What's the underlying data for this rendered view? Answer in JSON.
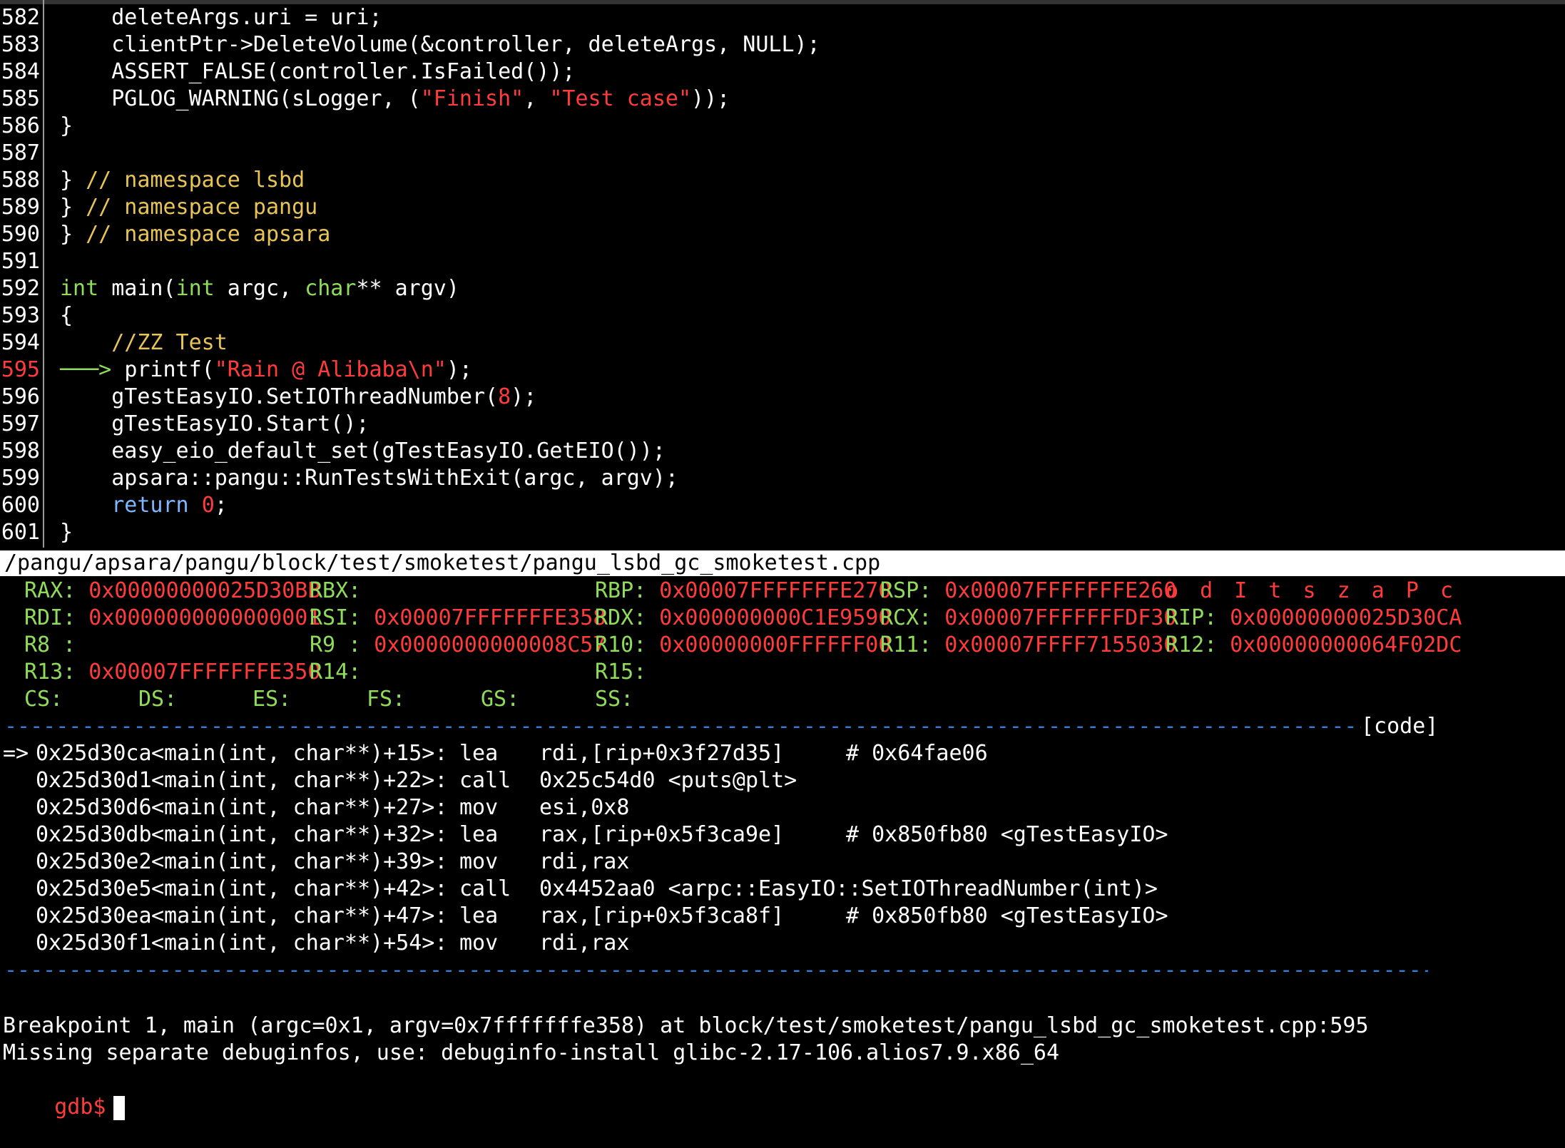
{
  "source": {
    "file_path": "/pangu/apsara/pangu/block/test/smoketest/pangu_lsbd_gc_smoketest.cpp",
    "current_line": "595",
    "lines": [
      {
        "n": "582",
        "segs": [
          [
            "p",
            "    deleteArgs.uri = uri;"
          ]
        ]
      },
      {
        "n": "583",
        "segs": [
          [
            "p",
            "    clientPtr->DeleteVolume(&controller, deleteArgs, NULL);"
          ]
        ]
      },
      {
        "n": "584",
        "segs": [
          [
            "p",
            "    ASSERT_FALSE(controller.IsFailed());"
          ]
        ]
      },
      {
        "n": "585",
        "segs": [
          [
            "p",
            "    PGLOG_WARNING(sLogger, ("
          ],
          [
            "s",
            "\"Finish\""
          ],
          [
            "p",
            ", "
          ],
          [
            "s",
            "\"Test case\""
          ],
          [
            "p",
            "));"
          ]
        ]
      },
      {
        "n": "586",
        "segs": [
          [
            "p",
            "}"
          ]
        ]
      },
      {
        "n": "587",
        "segs": []
      },
      {
        "n": "588",
        "segs": [
          [
            "p",
            "} "
          ],
          [
            "c",
            "// namespace lsbd"
          ]
        ]
      },
      {
        "n": "589",
        "segs": [
          [
            "p",
            "} "
          ],
          [
            "c",
            "// namespace pangu"
          ]
        ]
      },
      {
        "n": "590",
        "segs": [
          [
            "p",
            "} "
          ],
          [
            "c",
            "// namespace apsara"
          ]
        ]
      },
      {
        "n": "591",
        "segs": []
      },
      {
        "n": "592",
        "segs": [
          [
            "k",
            "int"
          ],
          [
            "p",
            " main("
          ],
          [
            "k",
            "int"
          ],
          [
            "p",
            " argc, "
          ],
          [
            "k",
            "char"
          ],
          [
            "p",
            "** argv)"
          ]
        ]
      },
      {
        "n": "593",
        "segs": [
          [
            "p",
            "{"
          ]
        ]
      },
      {
        "n": "594",
        "segs": [
          [
            "c",
            "    //ZZ Test"
          ]
        ]
      },
      {
        "n": "595",
        "segs": [
          [
            "a",
            "───> "
          ],
          [
            "p",
            "printf("
          ],
          [
            "s",
            "\"Rain @ Alibaba\\n\""
          ],
          [
            "p",
            ");"
          ]
        ]
      },
      {
        "n": "596",
        "segs": [
          [
            "p",
            "    gTestEasyIO.SetIOThreadNumber("
          ],
          [
            "s",
            "8"
          ],
          [
            "p",
            ");"
          ]
        ]
      },
      {
        "n": "597",
        "segs": [
          [
            "p",
            "    gTestEasyIO.Start();"
          ]
        ]
      },
      {
        "n": "598",
        "segs": [
          [
            "p",
            "    easy_eio_default_set(gTestEasyIO.GetEIO());"
          ]
        ]
      },
      {
        "n": "599",
        "segs": [
          [
            "p",
            "    apsara::pangu::RunTestsWithExit(argc, argv);"
          ]
        ]
      },
      {
        "n": "600",
        "segs": [
          [
            "r",
            "    return"
          ],
          [
            "p",
            " "
          ],
          [
            "s",
            "0"
          ],
          [
            "p",
            ";"
          ]
        ]
      },
      {
        "n": "601",
        "segs": [
          [
            "p",
            "}"
          ]
        ]
      }
    ]
  },
  "registers": {
    "rows": [
      [
        {
          "name": "RAX:",
          "value": "0x00000000025D30BB"
        },
        {
          "name": "RBX:",
          "value": ""
        },
        {
          "name": "RBP:",
          "value": "0x00007FFFFFFFE270"
        },
        {
          "name": "RSP:",
          "value": "0x00007FFFFFFFE260"
        },
        {
          "name": "",
          "value": "",
          "flags": "o d I t s z a P c"
        }
      ],
      [
        {
          "name": "RDI:",
          "value": "0x0000000000000001"
        },
        {
          "name": "RSI:",
          "value": "0x00007FFFFFFFE358"
        },
        {
          "name": "RDX:",
          "value": "0x000000000C1E9590"
        },
        {
          "name": "RCX:",
          "value": "0x00007FFFFFFFDF30"
        },
        {
          "name": "RIP:",
          "value": "0x00000000025D30CA"
        }
      ],
      [
        {
          "name": "R8 :",
          "value": ""
        },
        {
          "name": "R9 :",
          "value": "0x0000000000008C57"
        },
        {
          "name": "R10:",
          "value": "0x00000000FFFFFF00"
        },
        {
          "name": "R11:",
          "value": "0x00007FFFF7155030"
        },
        {
          "name": "R12:",
          "value": "0x00000000064F02DC"
        }
      ],
      [
        {
          "name": "R13:",
          "value": "0x00007FFFFFFFE350"
        },
        {
          "name": "R14:",
          "value": ""
        },
        {
          "name": "R15:",
          "value": ""
        },
        {
          "name": "",
          "value": ""
        },
        {
          "name": "",
          "value": ""
        }
      ],
      [
        {
          "name": "CS:",
          "value": ""
        },
        {
          "name": "DS:",
          "value": ""
        },
        {
          "name": "ES:",
          "value": ""
        },
        {
          "name": "FS:",
          "value": ""
        },
        {
          "name": "GS:",
          "value": ""
        },
        {
          "name": "SS:",
          "value": ""
        }
      ]
    ]
  },
  "disasm": {
    "section_label": "[code]",
    "rows": [
      {
        "marker": "=>",
        "addr": "0x25d30ca",
        "sym": "<main(int, char**)+15>:",
        "op": "lea",
        "args": "rdi,[rip+0x3f27d35]",
        "comment": "# 0x64fae06"
      },
      {
        "marker": "",
        "addr": "0x25d30d1",
        "sym": "<main(int, char**)+22>:",
        "op": "call",
        "args": "0x25c54d0 <puts@plt>",
        "comment": ""
      },
      {
        "marker": "",
        "addr": "0x25d30d6",
        "sym": "<main(int, char**)+27>:",
        "op": "mov",
        "args": "esi,0x8",
        "comment": ""
      },
      {
        "marker": "",
        "addr": "0x25d30db",
        "sym": "<main(int, char**)+32>:",
        "op": "lea",
        "args": "rax,[rip+0x5f3ca9e]",
        "comment": "# 0x850fb80 <gTestEasyIO>"
      },
      {
        "marker": "",
        "addr": "0x25d30e2",
        "sym": "<main(int, char**)+39>:",
        "op": "mov",
        "args": "rdi,rax",
        "comment": ""
      },
      {
        "marker": "",
        "addr": "0x25d30e5",
        "sym": "<main(int, char**)+42>:",
        "op": "call",
        "args": "0x4452aa0 <arpc::EasyIO::SetIOThreadNumber(int)>",
        "comment": ""
      },
      {
        "marker": "",
        "addr": "0x25d30ea",
        "sym": "<main(int, char**)+47>:",
        "op": "lea",
        "args": "rax,[rip+0x5f3ca8f]",
        "comment": "# 0x850fb80 <gTestEasyIO>"
      },
      {
        "marker": "",
        "addr": "0x25d30f1",
        "sym": "<main(int, char**)+54>:",
        "op": "mov",
        "args": "rdi,rax",
        "comment": ""
      }
    ]
  },
  "console": {
    "lines": [
      "Breakpoint 1, main (argc=0x1, argv=0x7fffffffe358) at block/test/smoketest/pangu_lsbd_gc_smoketest.cpp:595",
      "Missing separate debuginfos, use: debuginfo-install glibc-2.17-106.alios7.9.x86_64"
    ],
    "prompt": "gdb$"
  },
  "colors": {
    "background": "#000000",
    "keyword": "#8fdc5a",
    "string": "#ff3b3b",
    "comment": "#e8c457",
    "separator": "#3a7bd5"
  }
}
